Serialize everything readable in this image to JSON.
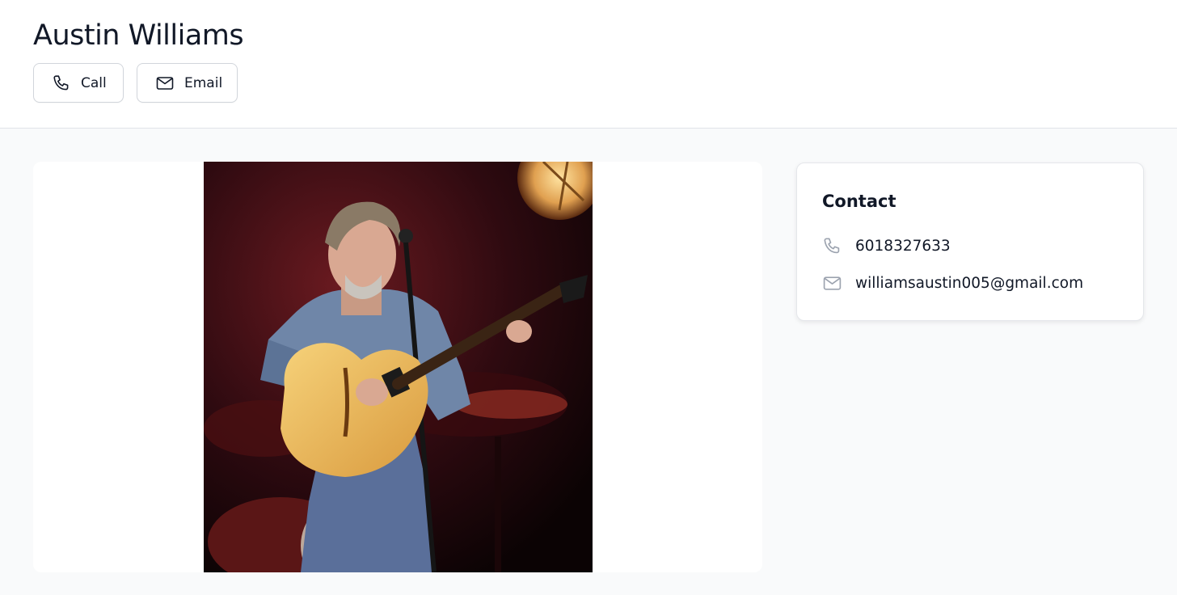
{
  "header": {
    "title": "Austin Williams",
    "call_label": "Call",
    "email_label": "Email"
  },
  "photo": {
    "description_icon": "performer-photo"
  },
  "contact": {
    "heading": "Contact",
    "phone": "6018327633",
    "email": "williamsaustin005@gmail.com"
  },
  "colors": {
    "page_bg": "#f9fafb",
    "card_bg": "#ffffff",
    "text": "#111827",
    "muted_icon": "#9ca3af",
    "border": "#d1d5db"
  }
}
